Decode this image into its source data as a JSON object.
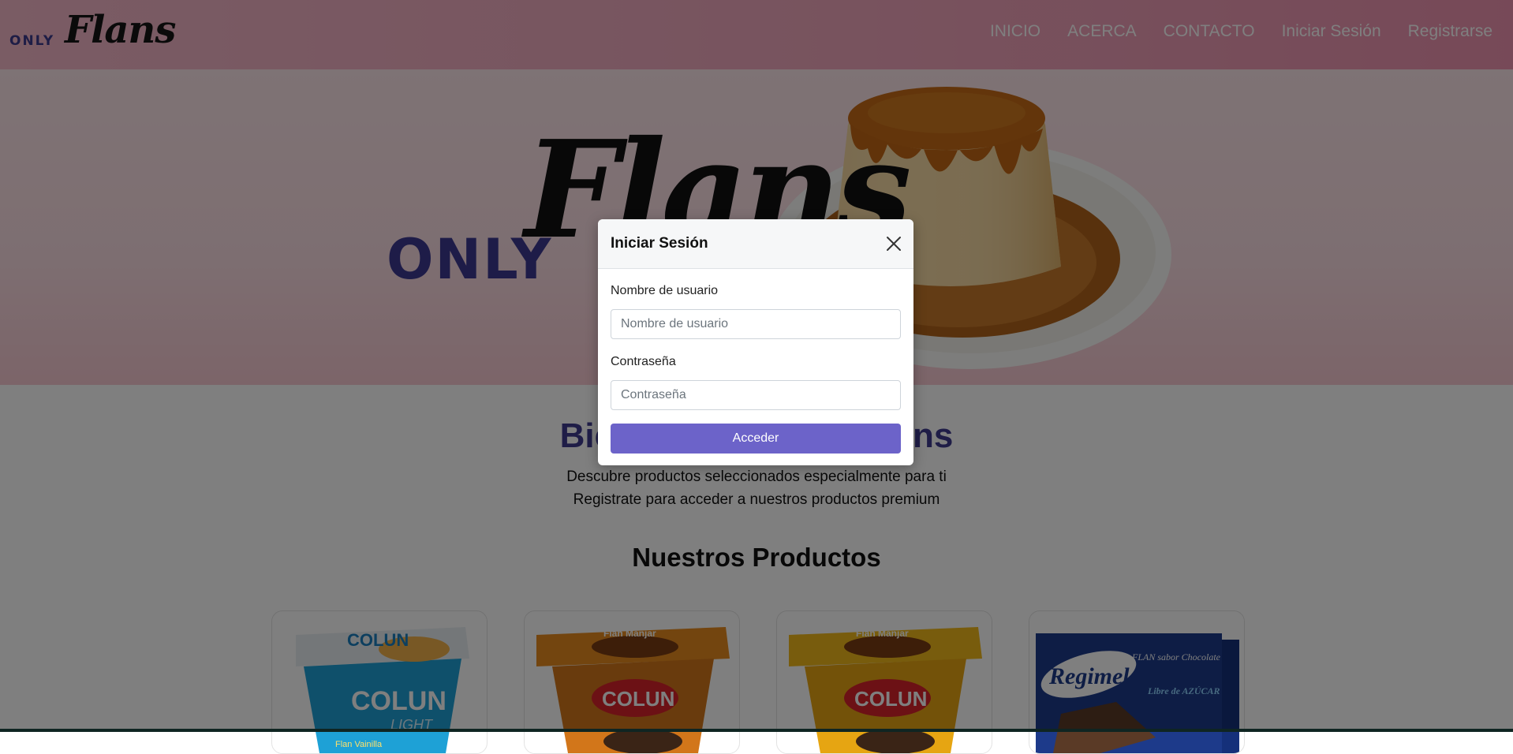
{
  "brand": {
    "only": "ONLY",
    "flans": "Flans"
  },
  "nav": {
    "items": [
      {
        "label": "INICIO"
      },
      {
        "label": "ACERCA"
      },
      {
        "label": "CONTACTO"
      },
      {
        "label": "Iniciar Sesión"
      },
      {
        "label": "Registrarse"
      }
    ]
  },
  "hero": {
    "only": "ONLY",
    "flans": "Flans"
  },
  "main": {
    "welcome": "Bienvenido a OnlyFlans",
    "subtitle_1": "Descubre productos seleccionados especialmente para ti",
    "subtitle_2": "Registrate para acceder a nuestros productos premium",
    "section_title": "Nuestros Productos"
  },
  "products": [
    {
      "brand": "COLUN",
      "variant": "LIGHT",
      "flavor": "Flan Vainilla",
      "color": "#1ea1d6"
    },
    {
      "brand": "COLUN",
      "variant": "",
      "flavor": "Flan Manjar",
      "color": "#e78a1e"
    },
    {
      "brand": "COLUN",
      "variant": "",
      "flavor": "Flan Manjar",
      "color": "#f0b81a"
    },
    {
      "brand": "Regimel",
      "variant": "Libre de AZÚCAR",
      "flavor": "FLAN sabor Chocolate",
      "color": "#1d3a8a"
    }
  ],
  "modal": {
    "title": "Iniciar Sesión",
    "username_label": "Nombre de usuario",
    "username_placeholder": "Nombre de usuario",
    "password_label": "Contraseña",
    "password_placeholder": "Contraseña",
    "submit_label": "Acceder"
  },
  "colors": {
    "accent": "#6c63c9",
    "brand_purple": "#3f3b8f",
    "nav_pink": "#f0a7bd"
  }
}
